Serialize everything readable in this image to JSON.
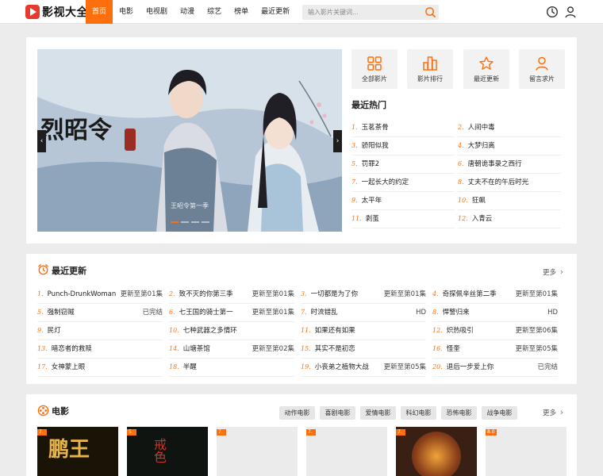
{
  "header": {
    "logo_text": "影视大全",
    "nav": [
      "首页",
      "电影",
      "电视剧",
      "动漫",
      "综艺",
      "榜单",
      "最近更新"
    ],
    "search_placeholder": "输入影片关键词..."
  },
  "banner": {
    "caption": "王昭令第一季",
    "prev": "‹",
    "next": "›",
    "active_slide": 1,
    "slide_count": 4
  },
  "quick_links": [
    {
      "label": "全部影片",
      "icon": "grid-icon"
    },
    {
      "label": "影片排行",
      "icon": "bar-chart-icon"
    },
    {
      "label": "最近更新",
      "icon": "star-icon"
    },
    {
      "label": "留言求片",
      "icon": "user-icon"
    }
  ],
  "hot": {
    "title": "最近热门",
    "items": [
      {
        "num": "1.",
        "title": "玉茗茶骨"
      },
      {
        "num": "2.",
        "title": "人间中毒"
      },
      {
        "num": "3.",
        "title": "骄阳似我"
      },
      {
        "num": "4.",
        "title": "大梦归离"
      },
      {
        "num": "5.",
        "title": "罚罪2"
      },
      {
        "num": "6.",
        "title": "唐朝诡事录之西行"
      },
      {
        "num": "7.",
        "title": "一起长大的约定"
      },
      {
        "num": "8.",
        "title": "丈夫不在的午后时光"
      },
      {
        "num": "9.",
        "title": "太平年"
      },
      {
        "num": "10.",
        "title": "狂飙"
      },
      {
        "num": "11.",
        "title": "剥茧"
      },
      {
        "num": "12.",
        "title": "入青云"
      }
    ]
  },
  "updates": {
    "title": "最近更新",
    "more": "更多",
    "items": [
      {
        "num": "1.",
        "title": "Punch-DrunkWoman",
        "status": "更新至第01集"
      },
      {
        "num": "2.",
        "title": "致不灭的你第三季",
        "status": "更新至第01集"
      },
      {
        "num": "3.",
        "title": "一切都是为了你",
        "status": "更新至第01集"
      },
      {
        "num": "4.",
        "title": "奇探佩辛丝第二季",
        "status": "更新至第01集"
      },
      {
        "num": "5.",
        "title": "强制窃贼",
        "status": "已完结"
      },
      {
        "num": "6.",
        "title": "七王国的骑士第一",
        "status": "更新至第01集"
      },
      {
        "num": "7.",
        "title": "时流错乱",
        "status": "HD"
      },
      {
        "num": "8.",
        "title": "悍警归来",
        "status": "HD"
      },
      {
        "num": "9.",
        "title": "民灯",
        "status": ""
      },
      {
        "num": "10.",
        "title": "七种武器之多情环",
        "status": ""
      },
      {
        "num": "11.",
        "title": "如果还有如果",
        "status": ""
      },
      {
        "num": "12.",
        "title": "炽热吸引",
        "status": "更新至第06集"
      },
      {
        "num": "13.",
        "title": "暗恋者的救赎",
        "status": ""
      },
      {
        "num": "14.",
        "title": "山塘茶馆",
        "status": "更新至第02集"
      },
      {
        "num": "15.",
        "title": "其实不是初恋",
        "status": ""
      },
      {
        "num": "16.",
        "title": "怪奎",
        "status": "更新至第05集"
      },
      {
        "num": "17.",
        "title": "女神蒙上眼",
        "status": ""
      },
      {
        "num": "18.",
        "title": "半醒",
        "status": ""
      },
      {
        "num": "19.",
        "title": "小丧弟之植物大战",
        "status": "更新至第05集"
      },
      {
        "num": "20.",
        "title": "退后一步爱上你",
        "status": "已完结"
      }
    ]
  },
  "movies": {
    "title": "电影",
    "more": "更多",
    "tags": [
      "动作电影",
      "喜剧电影",
      "爱情电影",
      "科幻电影",
      "恐怖电影",
      "战争电影"
    ],
    "posters": [
      {
        "score": "7.",
        "title_art": "鹏王"
      },
      {
        "score": "5.",
        "title_art": "戒色"
      },
      {
        "score": "7.",
        "title_art": ""
      },
      {
        "score": "7.",
        "title_art": ""
      },
      {
        "score": "7.",
        "title_art": ""
      },
      {
        "score": "8.0",
        "title_art": ""
      }
    ]
  },
  "colors": {
    "accent": "#fd6f0c",
    "logo": "#e53b2c"
  }
}
